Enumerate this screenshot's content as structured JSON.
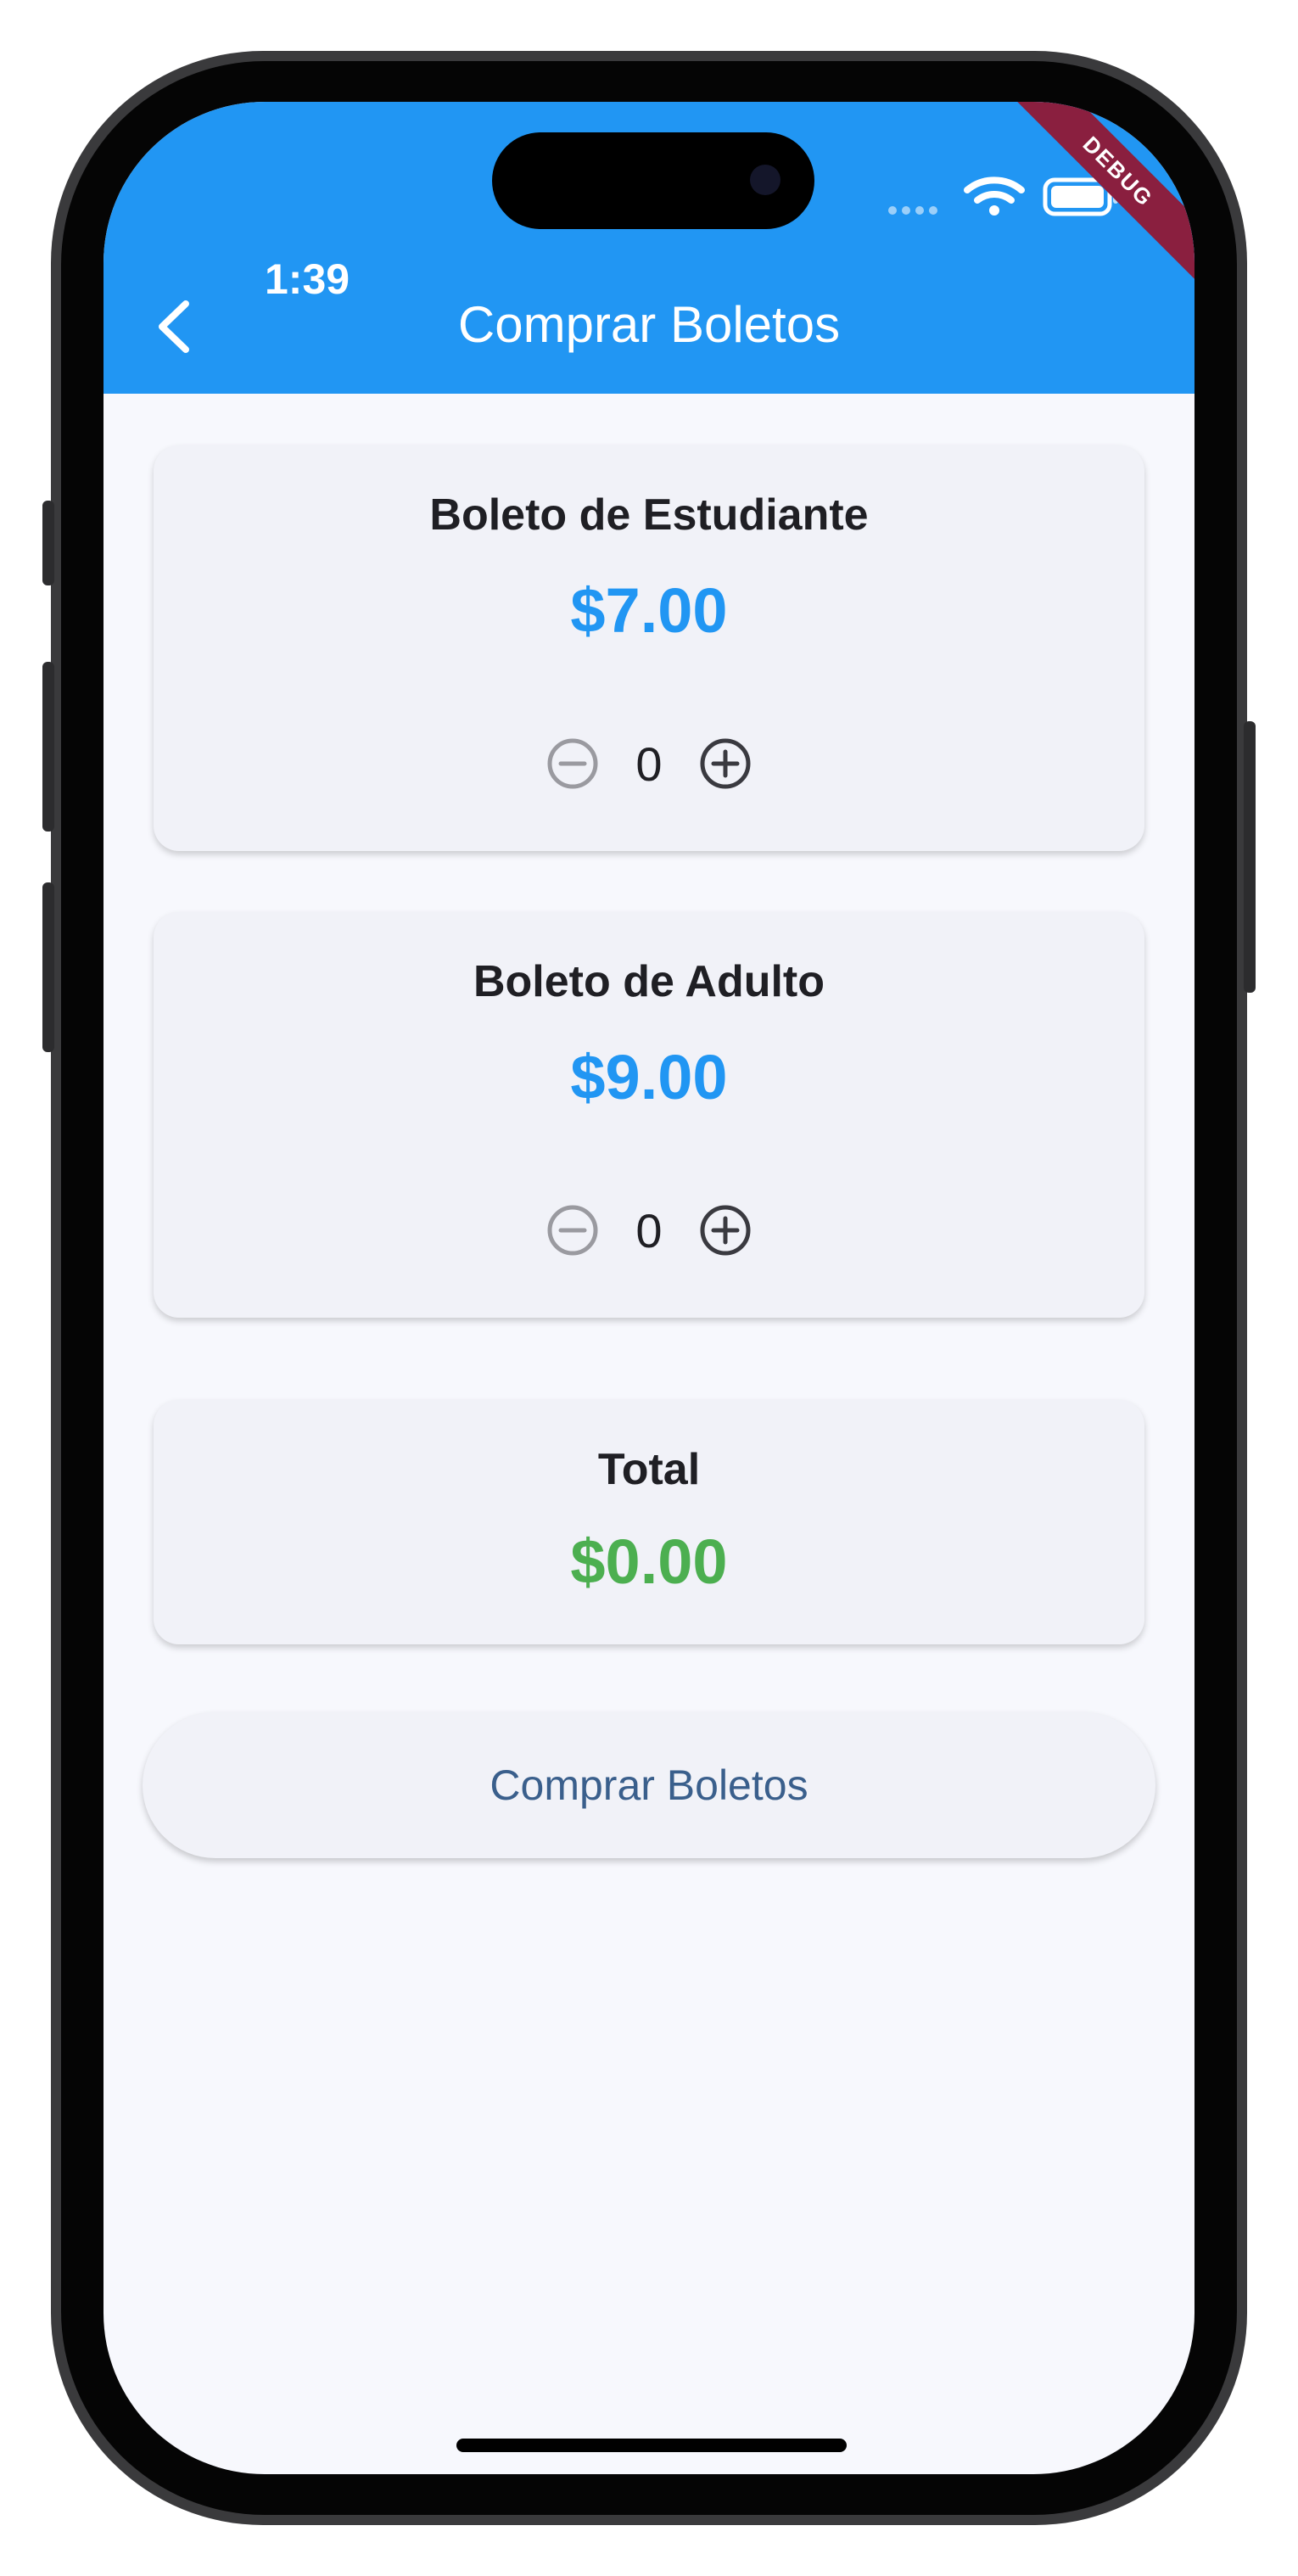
{
  "status_bar": {
    "time": "1:39",
    "debug_banner": "DEBUG",
    "icons": [
      "signal-icon",
      "wifi-icon",
      "battery-icon"
    ]
  },
  "app_bar": {
    "title": "Comprar Boletos",
    "back_icon": "chevron-left-icon",
    "background_color": "#2196f3"
  },
  "tickets": [
    {
      "title": "Boleto de Estudiante",
      "price": "$7.00",
      "quantity": "0",
      "decrement_icon": "minus-circle-icon",
      "increment_icon": "plus-circle-icon"
    },
    {
      "title": "Boleto de Adulto",
      "price": "$9.00",
      "quantity": "0",
      "decrement_icon": "minus-circle-icon",
      "increment_icon": "plus-circle-icon"
    }
  ],
  "total": {
    "label": "Total",
    "value": "$0.00",
    "color": "#4caf50"
  },
  "buy_button": {
    "label": "Comprar Boletos"
  },
  "colors": {
    "accent": "#2196f3",
    "total": "#4caf50",
    "card_background": "#f1f2f8",
    "page_background": "#f7f8fd"
  }
}
